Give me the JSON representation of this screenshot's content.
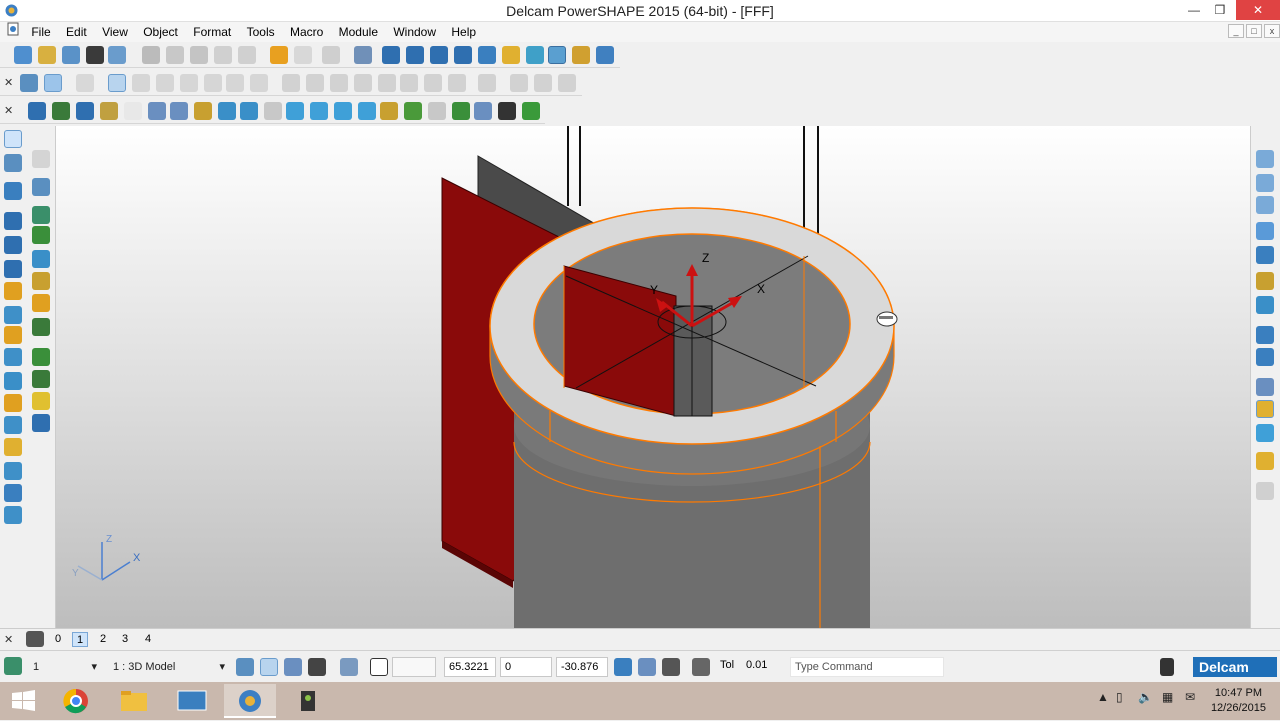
{
  "window": {
    "title": "Delcam PowerSHAPE 2015 (64-bit) - [FFF]",
    "minimize": "—",
    "restore": "❒",
    "close": "✕"
  },
  "menu": [
    "File",
    "Edit",
    "View",
    "Object",
    "Format",
    "Tools",
    "Macro",
    "Module",
    "Window",
    "Help"
  ],
  "viewport": {
    "axis_labels": {
      "x": "X",
      "y": "Y",
      "z": "Z"
    },
    "corner_axis": {
      "x": "X",
      "y": "Y",
      "z": "Z"
    },
    "colors": {
      "surface_red": "#8a0a0a",
      "cylinder": "#6e6e6e",
      "selection": "#ff7a00",
      "ring": "#d8d8d8"
    }
  },
  "levels": [
    "0",
    "1",
    "2",
    "3",
    "4"
  ],
  "active_level": "1",
  "status": {
    "level_select": "1",
    "model_select": "1  : 3D Model",
    "coord_x": "65.3221",
    "coord_y": "0",
    "coord_z": "-30.876",
    "tol_label": "Tol",
    "tol_value": "0.01",
    "command_placeholder": "Type Command",
    "brand": "Delcam"
  },
  "taskbar": {
    "time": "10:47 PM",
    "date": "12/26/2015",
    "colors": {
      "bar": "#c9b8ad"
    }
  }
}
